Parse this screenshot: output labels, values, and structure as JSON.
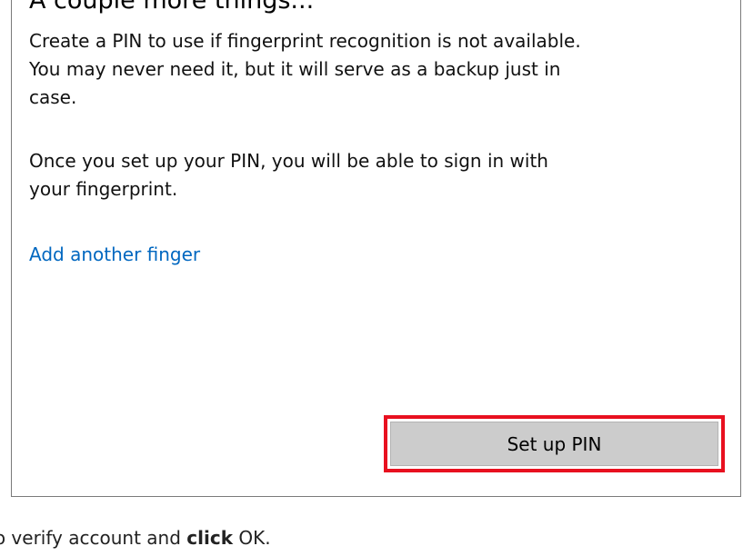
{
  "dialog": {
    "title": "A couple more things...",
    "paragraph_1": "Create a PIN to use if fingerprint recognition is not available.\nYou may never need it, but it will serve as a backup just in\ncase.",
    "paragraph_2": "Once you set up your PIN, you will be able to sign in with\nyour fingerprint.",
    "link_label": "Add another finger",
    "primary_button_label": "Set up PIN"
  },
  "colors": {
    "link": "#0067c0",
    "highlight_border": "#e8101f",
    "button_bg": "#cccccc"
  },
  "caption": {
    "prefix": "to verify account and ",
    "bold": "click",
    "suffix": " OK."
  }
}
